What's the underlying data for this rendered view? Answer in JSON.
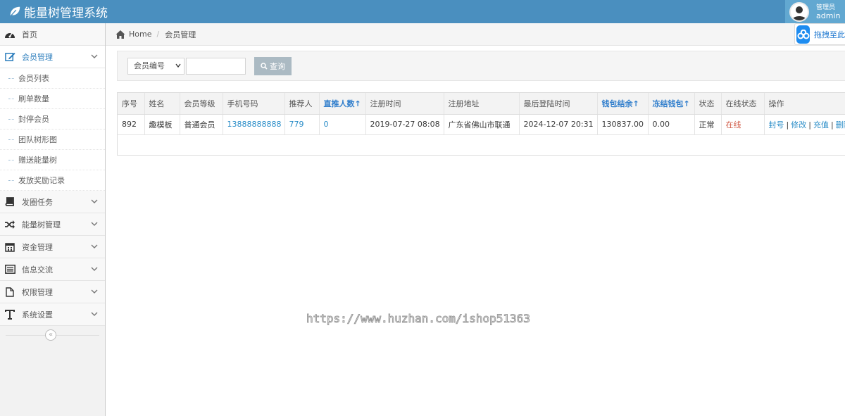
{
  "header": {
    "app_title": "能量树管理系统",
    "user_role": "管理员",
    "user_name": "admin"
  },
  "sidebar": {
    "items": [
      {
        "label": "首页",
        "icon": "dashboard-icon"
      },
      {
        "label": "会员管理",
        "icon": "edit-icon",
        "active": true
      },
      {
        "label": "发圈任务",
        "icon": "book-icon"
      },
      {
        "label": "能量树管理",
        "icon": "random-icon"
      },
      {
        "label": "资金管理",
        "icon": "calendar-icon"
      },
      {
        "label": "信息交流",
        "icon": "list-alt-icon"
      },
      {
        "label": "权限管理",
        "icon": "file-icon"
      },
      {
        "label": "系统设置",
        "icon": "text-tool-icon"
      }
    ],
    "member_sub": [
      "会员列表",
      "刷单数量",
      "封停会员",
      "团队树形图",
      "赠送能量树",
      "发放奖励记录"
    ]
  },
  "breadcrumb": {
    "home": "Home",
    "current": "会员管理"
  },
  "float_button": {
    "label": "拖拽至此"
  },
  "search": {
    "select_value": "会员编号",
    "keyword_value": "",
    "query_label": "查询"
  },
  "table": {
    "headers": [
      "序号",
      "姓名",
      "会员等级",
      "手机号码",
      "推荐人",
      "直推人数↑",
      "注册时间",
      "注册地址",
      "最后登陆时间",
      "钱包结余↑",
      "冻结钱包↑",
      "状态",
      "在线状态",
      "操作"
    ],
    "rows": [
      {
        "id": "892",
        "name": "趣模板",
        "level": "普通会员",
        "phone": "13888888888",
        "referrer": "779",
        "direct_count": "0",
        "reg_time": "2019-07-27 08:08",
        "reg_address": "广东省佛山市联通",
        "last_login": "2024-12-07 20:31",
        "wallet": "130837.00",
        "frozen": "0.00",
        "status": "正常",
        "online": "在线",
        "ops": [
          "封号",
          "修改",
          "充值",
          "删除"
        ]
      }
    ]
  },
  "watermark": "https://www.huzhan.com/ishop51363",
  "colors": {
    "navbar": "#4a8fbf",
    "link": "#2a8dc8",
    "online": "#d15b47",
    "query_button": "#abbac3"
  }
}
